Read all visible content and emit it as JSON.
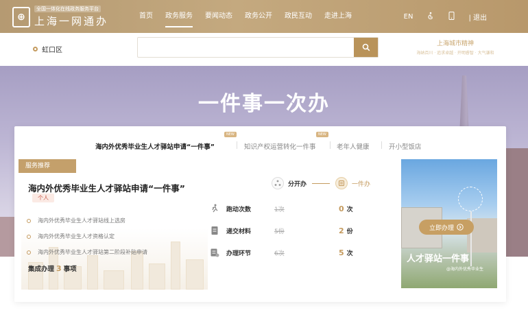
{
  "header": {
    "logo_subtitle": "全国一体化在线政务服务平台",
    "logo_title": "上海一网通办",
    "nav": [
      "首页",
      "政务服务",
      "要闻动态",
      "政务公开",
      "政民互动",
      "走进上海"
    ],
    "active_nav": "政务服务",
    "lang": "EN",
    "logout": "| 退出"
  },
  "search": {
    "location": "虹口区",
    "placeholder": "",
    "promo_title": "上海城市精神",
    "promo_sub": "海纳百川 · 追求卓越 · 开明睿智 · 大气谦和"
  },
  "banner": {
    "title": "一件事一次办"
  },
  "tabs": [
    {
      "label": "海内外优秀毕业生人才驿站申请“一件事”",
      "new": true,
      "active": true
    },
    {
      "label": "知识产权运营转化一件事",
      "new": true,
      "active": false
    },
    {
      "label": "老年人健康",
      "new": false,
      "active": false
    },
    {
      "label": "开小型饭店",
      "new": false,
      "active": false
    }
  ],
  "new_badge": "NEW",
  "service": {
    "tag": "服务推荐",
    "title": "海内外优秀毕业生人才驿站申请“一件事”",
    "audience": "个人",
    "items": [
      "海内外优秀毕业生人才驿站线上选房",
      "海内外优秀毕业生人才资格认定",
      "海内外优秀毕业生人才驿站第二阶段补贴申请"
    ],
    "summary_prefix": "集成办理",
    "summary_count": "3",
    "summary_suffix": "事项"
  },
  "mode": {
    "separate": "分开办",
    "combined": "一件办"
  },
  "stats": [
    {
      "label": "跑动次数",
      "old": "1次",
      "new": "0",
      "unit": "次"
    },
    {
      "label": "递交材料",
      "old": "5份",
      "new": "2",
      "unit": "份"
    },
    {
      "label": "办理环节",
      "old": "6次",
      "new": "5",
      "unit": "次"
    }
  ],
  "promo": {
    "cta": "立即办理",
    "title": "人才驿站一件事",
    "subtitle": "@海内外优秀毕业生"
  },
  "colors": {
    "brand_gold": "#c49a5e",
    "header_gold": "#b59a72",
    "banner_lavender": "#a69ec3"
  }
}
